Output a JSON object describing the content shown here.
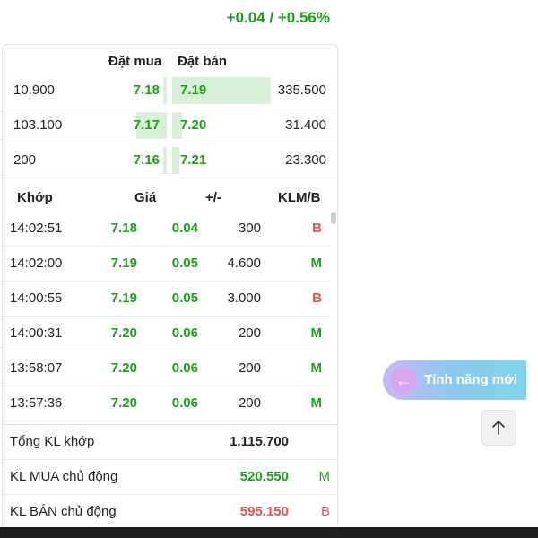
{
  "header": {
    "change_text": "+0.04 / +0.56%"
  },
  "orderbook": {
    "buy_header": "Đặt mua",
    "sell_header": "Đặt bán",
    "rows": [
      {
        "buy_volume": "10.900",
        "buy_price": "7.18",
        "buy_depth": 0.04,
        "sell_price": "7.19",
        "sell_volume": "335.500",
        "sell_depth": 1.0
      },
      {
        "buy_volume": "103.100",
        "buy_price": "7.17",
        "buy_depth": 0.31,
        "sell_price": "7.20",
        "sell_volume": "31.400",
        "sell_depth": 0.1
      },
      {
        "buy_volume": "200",
        "buy_price": "7.16",
        "buy_depth": 0.01,
        "sell_price": "7.21",
        "sell_volume": "23.300",
        "sell_depth": 0.07
      }
    ]
  },
  "trades": {
    "headers": {
      "time": "Khớp",
      "price": "Giá",
      "change": "+/-",
      "volume": "KLM/B"
    },
    "rows": [
      {
        "time": "14:02:51",
        "price": "7.18",
        "change": "0.04",
        "volume": "300",
        "side": "B"
      },
      {
        "time": "14:02:00",
        "price": "7.19",
        "change": "0.05",
        "volume": "4.600",
        "side": "M"
      },
      {
        "time": "14:00:55",
        "price": "7.19",
        "change": "0.05",
        "volume": "3.000",
        "side": "B"
      },
      {
        "time": "14:00:31",
        "price": "7.20",
        "change": "0.06",
        "volume": "200",
        "side": "M"
      },
      {
        "time": "13:58:07",
        "price": "7.20",
        "change": "0.06",
        "volume": "200",
        "side": "M"
      },
      {
        "time": "13:57:36",
        "price": "7.20",
        "change": "0.06",
        "volume": "200",
        "side": "M"
      }
    ]
  },
  "summary": {
    "total_label": "Tổng KL khớp",
    "total_value": "1.115.700",
    "buy_label": "KL MUA chủ động",
    "buy_value": "520.550",
    "buy_tag": "M",
    "sell_label": "KL BÁN chủ động",
    "sell_value": "595.150",
    "sell_tag": "B"
  },
  "new_feature": {
    "label": "Tính năng mới",
    "icon": "arrow-left-icon"
  },
  "scroll_top": {
    "icon": "arrow-up-icon"
  },
  "colors": {
    "up": "#1aa11a",
    "sell": "#e05050",
    "depth": "#d8f0d8"
  }
}
